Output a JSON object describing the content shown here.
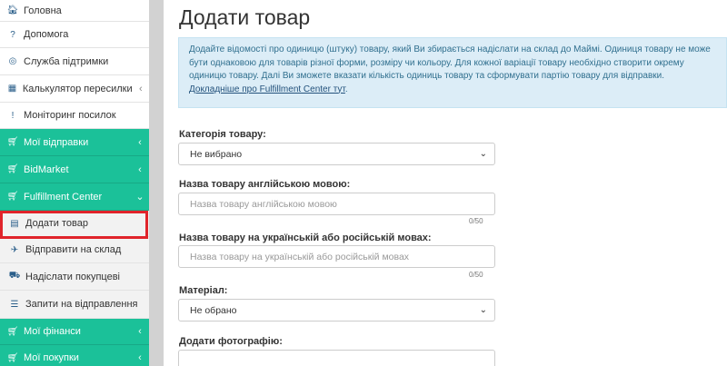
{
  "sidebar": {
    "items": [
      {
        "label": "Головна",
        "icon": "home-icon",
        "glyph": "🏠︎",
        "style": "plain"
      },
      {
        "label": "Допомога",
        "icon": "question-icon",
        "glyph": "?",
        "style": "plain"
      },
      {
        "label": "Служба підтримки",
        "icon": "lifebuoy-icon",
        "glyph": "◎",
        "style": "plain"
      },
      {
        "label": "Калькулятор пересилки",
        "icon": "calculator-icon",
        "glyph": "▦",
        "style": "plain",
        "chevron": "‹"
      },
      {
        "label": "Моніторинг посилок",
        "icon": "exclamation-icon",
        "glyph": "!",
        "style": "plain"
      },
      {
        "label": "Мої відправки",
        "icon": "cart-icon",
        "glyph": "🛒︎",
        "style": "green",
        "chevron": "‹"
      },
      {
        "label": "BidMarket",
        "icon": "cart-icon",
        "glyph": "🛒︎",
        "style": "green",
        "chevron": "‹"
      },
      {
        "label": "Fulfillment Center",
        "icon": "cart-icon",
        "glyph": "🛒︎",
        "style": "green",
        "chevron": "⌄"
      },
      {
        "label": "Додати товар",
        "icon": "file-icon",
        "glyph": "▤",
        "style": "sub active"
      },
      {
        "label": "Відправити на склад",
        "icon": "plane-icon",
        "glyph": "✈︎",
        "style": "sub"
      },
      {
        "label": "Надіслати покупцеві",
        "icon": "truck-icon",
        "glyph": "⛟",
        "style": "sub"
      },
      {
        "label": "Запити на відправлення",
        "icon": "list-icon",
        "glyph": "☰",
        "style": "sub"
      },
      {
        "label": "Мої фінанси",
        "icon": "cart-icon",
        "glyph": "🛒︎",
        "style": "green",
        "chevron": "‹"
      },
      {
        "label": "Мої покупки",
        "icon": "cart-icon",
        "glyph": "🛒︎",
        "style": "green",
        "chevron": "‹"
      }
    ]
  },
  "main": {
    "title": "Додати товар",
    "info_text": "Додайте відомості про одиницю (штуку) товару, який Ви збирається надіслати на склад до Маймі. Одиниця товару не може бути однаковою для товарів різної форми, розміру чи кольору. Для кожної варіації товару необхідно створити окрему одиницю товару. Далі Ви зможете вказати кількість одиниць товару та сформувати партію товару для відправки.",
    "info_link": "Докладніше про Fulfillment Center тут",
    "category_label": "Категорія товару:",
    "category_value": "Не вибрано",
    "name_en_label": "Назва товару англійською мовою:",
    "name_en_placeholder": "Назва товару англійською мовою",
    "name_en_counter": "0/50",
    "name_ua_label": "Назва товару на українській або російській мовах:",
    "name_ua_placeholder": "Назва товару на українській або російській мовах",
    "name_ua_counter": "0/50",
    "material_label": "Матеріал:",
    "material_value": "Не обрано",
    "photo_label": "Додати фотографію:"
  },
  "colors": {
    "accent_green": "#1bc199",
    "info_bg": "#dcedf7",
    "highlight_red": "#e0242b"
  }
}
